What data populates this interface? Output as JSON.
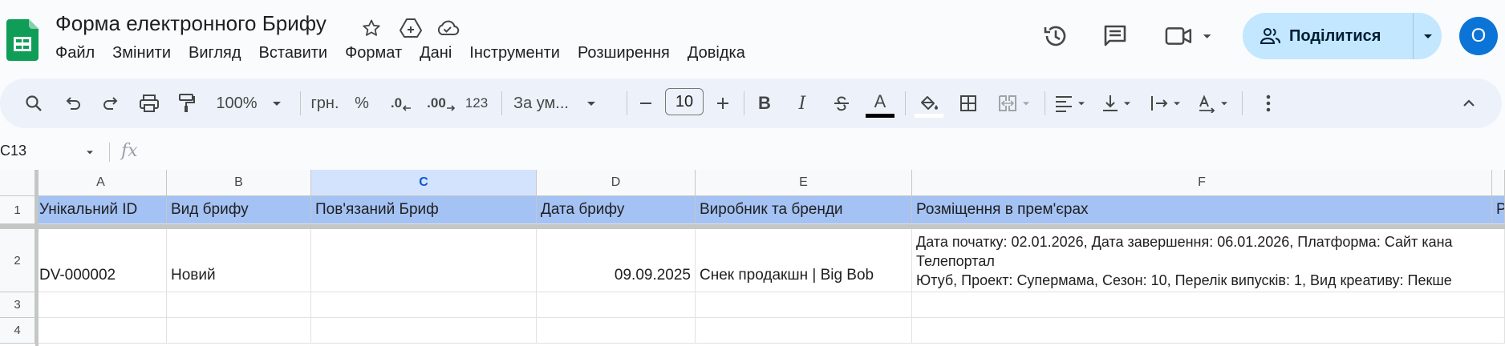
{
  "app": {
    "doc_title": "Форма електронного Брифу",
    "menu": [
      "Файл",
      "Змінити",
      "Вигляд",
      "Вставити",
      "Формат",
      "Дані",
      "Інструменти",
      "Розширення",
      "Довідка"
    ],
    "share_label": "Поділитися",
    "avatar_initial": "О",
    "icons": {
      "star": "star-icon",
      "move": "move-to-drive-icon",
      "cloud": "cloud-saved-icon",
      "history": "version-history-icon",
      "comments": "comments-icon",
      "meet": "video-call-icon"
    }
  },
  "toolbar": {
    "zoom": "100%",
    "currency": "грн.",
    "percent": "%",
    "dec_decrease": ".0",
    "dec_increase": ".00",
    "number_format": "123",
    "font": "За ум...",
    "font_size": "10",
    "bold": "B",
    "italic": "I",
    "text_color_letter": "A"
  },
  "formula_bar": {
    "name_box": "C13",
    "fx": "fx"
  },
  "sheet": {
    "columns": [
      "A",
      "B",
      "C",
      "D",
      "E",
      "F"
    ],
    "selected_column": "C",
    "rows": [
      "1",
      "2",
      "3",
      "4"
    ],
    "header_row": [
      "Унікальний ID",
      "Вид брифу",
      "Пов'язаний Бриф",
      "Дата брифу",
      "Виробник та бренди",
      "Розміщення в прем'єрах",
      "Р"
    ],
    "row2": {
      "a": "DV-000002",
      "b": "Новий",
      "c": "",
      "d": "09.09.2025",
      "e": "Снек продакшн | Big Bob",
      "f_line1": "Дата початку: 02.01.2026, Дата завершення: 06.01.2026, Платформа: Сайт кана",
      "f_line2": "Телепортал",
      "f_line3": "Ютуб, Проект: Супермама, Сезон: 10, Перелік випусків: 1, Вид креативу: Пекше"
    },
    "colors": {
      "header_fill": "#a4c2f4",
      "selected_col": "#d3e3fd"
    }
  }
}
